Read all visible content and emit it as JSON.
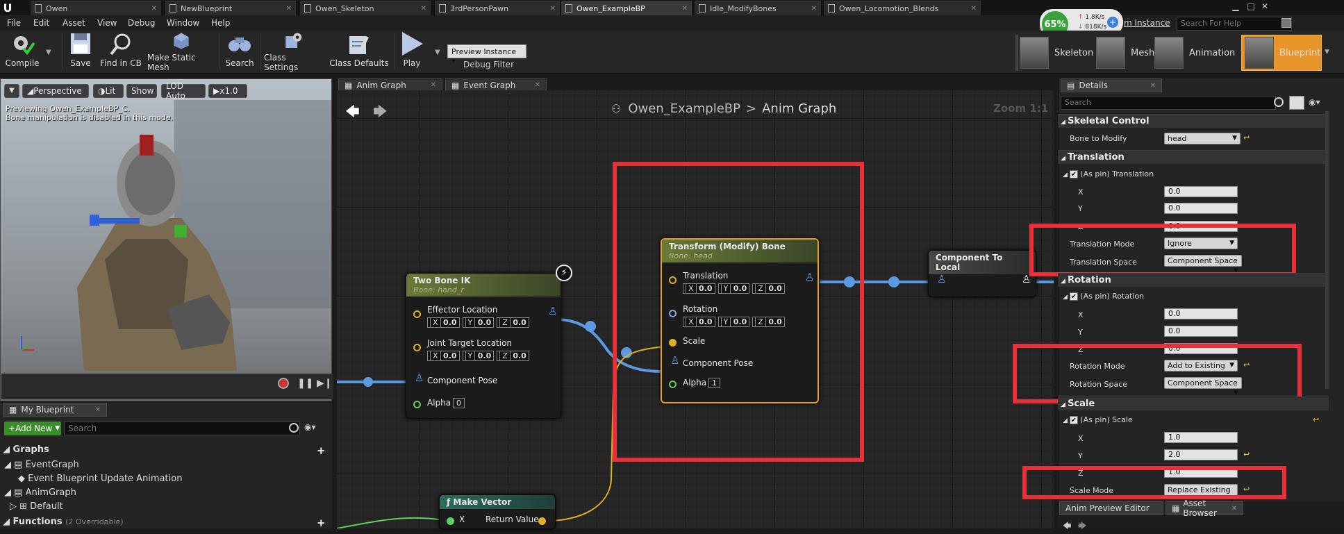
{
  "app": {
    "logo": "U"
  },
  "doc_tabs": [
    {
      "label": "Owen",
      "active": false
    },
    {
      "label": "NewBlueprint",
      "active": false
    },
    {
      "label": "Owen_Skeleton",
      "active": false
    },
    {
      "label": "3rdPersonPawn",
      "active": false
    },
    {
      "label": "Owen_ExampleBP",
      "active": true
    },
    {
      "label": "Idle_ModifyBones",
      "active": false
    },
    {
      "label": "Owen_Locomotion_Blends",
      "active": false
    }
  ],
  "menu": [
    "File",
    "Edit",
    "Asset",
    "View",
    "Debug",
    "Window",
    "Help"
  ],
  "network": {
    "percent": "65%",
    "up": "1.8K/s",
    "down": "818K/s",
    "plus": "+"
  },
  "anim_instance_label": "m Instance",
  "help_search_placeholder": "Search For Help",
  "toolbar": {
    "compile": "Compile",
    "save": "Save",
    "find": "Find in CB",
    "static_mesh": "Make Static Mesh",
    "search": "Search",
    "class_settings": "Class Settings",
    "class_defaults": "Class Defaults",
    "play": "Play",
    "preview_instance": "Preview Instance",
    "debug_filter": "Debug Filter"
  },
  "modes": {
    "skeleton": "Skeleton",
    "mesh": "Mesh",
    "animation": "Animation",
    "blueprint": "Blueprint"
  },
  "viewport": {
    "perspective": "Perspective",
    "lit": "Lit",
    "show": "Show",
    "lod": "LOD Auto",
    "speed": "x1.0",
    "info1": "Previewing Owen_ExampleBP_C.",
    "info2": "Bone manipulation is disabled in this mode."
  },
  "my_blueprint": {
    "tab": "My Blueprint",
    "add_new": "Add New",
    "search_placeholder": "Search",
    "graphs": "Graphs",
    "event_graph": "EventGraph",
    "event_update": "Event Blueprint Update Animation",
    "anim_graph": "AnimGraph",
    "default": "Default",
    "functions": "Functions",
    "functions_hint": "(2 Overridable)"
  },
  "graph_tabs": [
    "Anim Graph",
    "Event Graph"
  ],
  "breadcrumb": {
    "root": "Owen_ExampleBP",
    "sep": ">",
    "current": "Anim Graph"
  },
  "zoom": "Zoom 1:1",
  "nodes": {
    "two_bone": {
      "title": "Two Bone IK",
      "bone": "Bone: hand_r",
      "effector": "Effector Location",
      "joint": "Joint Target Location",
      "pose": "Component Pose",
      "alpha": "Alpha",
      "alpha_val": "0"
    },
    "transform": {
      "title": "Transform (Modify) Bone",
      "bone": "Bone: head",
      "translation": "Translation",
      "rotation": "Rotation",
      "scale": "Scale",
      "pose": "Component Pose",
      "alpha": "Alpha",
      "alpha_val": "1"
    },
    "to_local": {
      "title": "Component To Local"
    },
    "make_vector": {
      "title": "Make Vector",
      "x": "X",
      "ret": "Return Value"
    },
    "vec_labels": [
      "X",
      "Y",
      "Z"
    ],
    "vec_val": "0.0"
  },
  "details": {
    "tab": "Details",
    "search_placeholder": "Search",
    "skeletal_control": "Skeletal Control",
    "bone_to_modify": "Bone to Modify",
    "bone": "head",
    "translation": "Translation",
    "as_pin_translation": "(As pin) Translation",
    "x": "X",
    "y": "Y",
    "z": "Z",
    "t_x": "0.0",
    "t_y": "0.0",
    "t_z": "0.0",
    "translation_mode": "Translation Mode",
    "translation_mode_val": "Ignore",
    "translation_space": "Translation Space",
    "translation_space_val": "Component Space",
    "rotation": "Rotation",
    "as_pin_rotation": "(As pin) Rotation",
    "r_x": "0.0",
    "r_y": "0.0",
    "r_z": "0.0",
    "rotation_mode": "Rotation Mode",
    "rotation_mode_val": "Add to Existing",
    "rotation_space": "Rotation Space",
    "rotation_space_val": "Component Space",
    "scale": "Scale",
    "as_pin_scale": "(As pin) Scale",
    "s_x": "1.0",
    "s_y": "2.0",
    "s_z": "1.0",
    "scale_mode": "Scale Mode",
    "scale_mode_val": "Replace Existing"
  },
  "bottom_tabs": [
    "Anim Preview Editor",
    "Asset Browser"
  ],
  "colors": {
    "accent": "#e8952a",
    "highlight": "#e8303a",
    "wire": "#4a90d9",
    "exec_wire": "#e0b020"
  }
}
